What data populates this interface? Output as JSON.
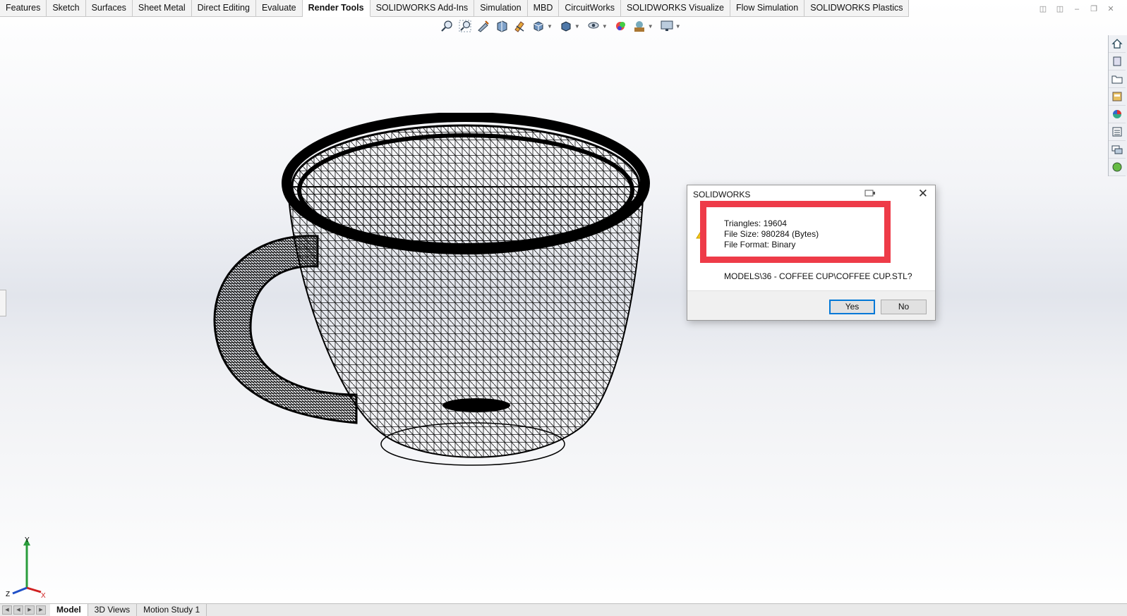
{
  "command_tabs": [
    {
      "label": "Features"
    },
    {
      "label": "Sketch"
    },
    {
      "label": "Surfaces"
    },
    {
      "label": "Sheet Metal"
    },
    {
      "label": "Direct Editing"
    },
    {
      "label": "Evaluate"
    },
    {
      "label": "Render Tools",
      "active": true
    },
    {
      "label": "SOLIDWORKS Add-Ins"
    },
    {
      "label": "Simulation"
    },
    {
      "label": "MBD"
    },
    {
      "label": "CircuitWorks"
    },
    {
      "label": "SOLIDWORKS Visualize"
    },
    {
      "label": "Flow Simulation"
    },
    {
      "label": "SOLIDWORKS Plastics"
    }
  ],
  "view_toolbar_icons": [
    "zoom-to-fit-icon",
    "zoom-to-area-icon",
    "previous-view-icon",
    "section-view-icon",
    "dynamic-annotation-icon",
    "view-orientation-icon",
    "display-style-icon",
    "hide-show-items-icon",
    "edit-appearance-icon",
    "apply-scene-icon",
    "view-settings-icon"
  ],
  "task_pane_icons": [
    "home-icon",
    "resources-icon",
    "design-library-icon",
    "file-explorer-icon",
    "view-palette-icon",
    "appearances-icon",
    "custom-properties-icon",
    "forum-icon"
  ],
  "triad": {
    "x": "X",
    "y": "Y",
    "z": "Z"
  },
  "bottom_tabs": [
    {
      "label": "Model",
      "active": true
    },
    {
      "label": "3D Views"
    },
    {
      "label": "Motion Study 1"
    }
  ],
  "dialog": {
    "title": "SOLIDWORKS",
    "lines": [
      "Triangles: 19604",
      "File Size: 980284 (Bytes)",
      "File Format: Binary"
    ],
    "path_line": "MODELS\\36 - COFFEE CUP\\COFFEE CUP.STL?",
    "yes_label": "Yes",
    "no_label": "No",
    "highlight_color": "#ee3b48"
  }
}
